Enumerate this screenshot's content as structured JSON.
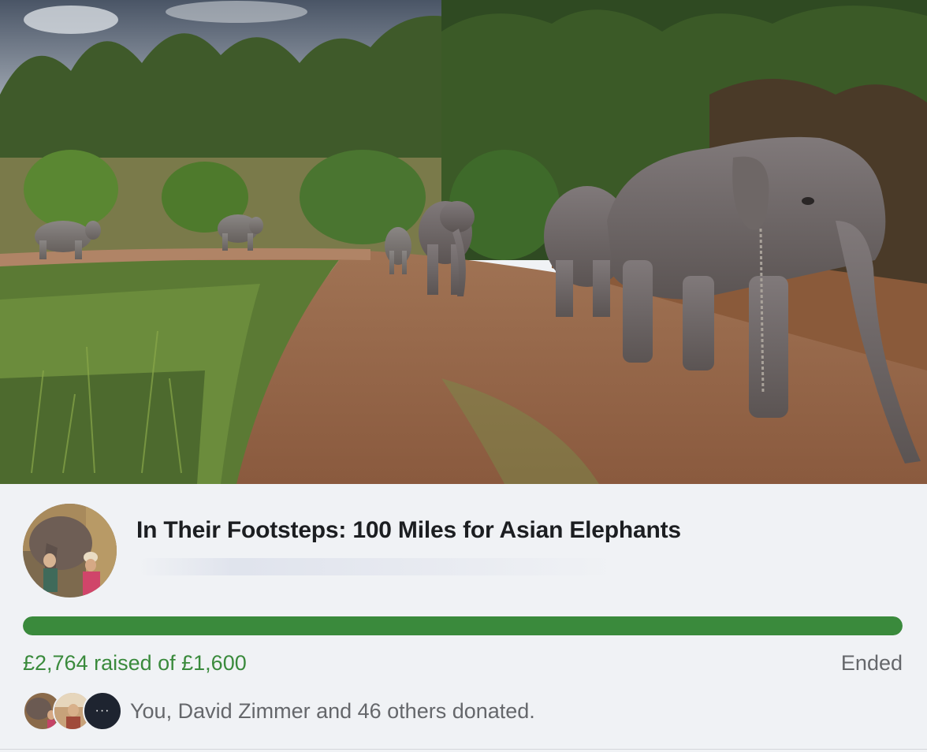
{
  "fundraiser": {
    "cover_image": "elephants-walking-on-dirt-road-photo",
    "profile_image": "people-with-elephant-photo",
    "title": "In Their Footsteps: 100 Miles for Asian Elephants",
    "raised_text": "£2,764 raised of £1,600",
    "progress": 1.0,
    "status": "Ended",
    "donors_text": "You, David Zimmer and 46 others donated.",
    "more_donors_glyph": "···"
  },
  "colors": {
    "accent_green": "#3a8a3c",
    "muted_text": "#65676b",
    "background": "#f0f2f5"
  }
}
